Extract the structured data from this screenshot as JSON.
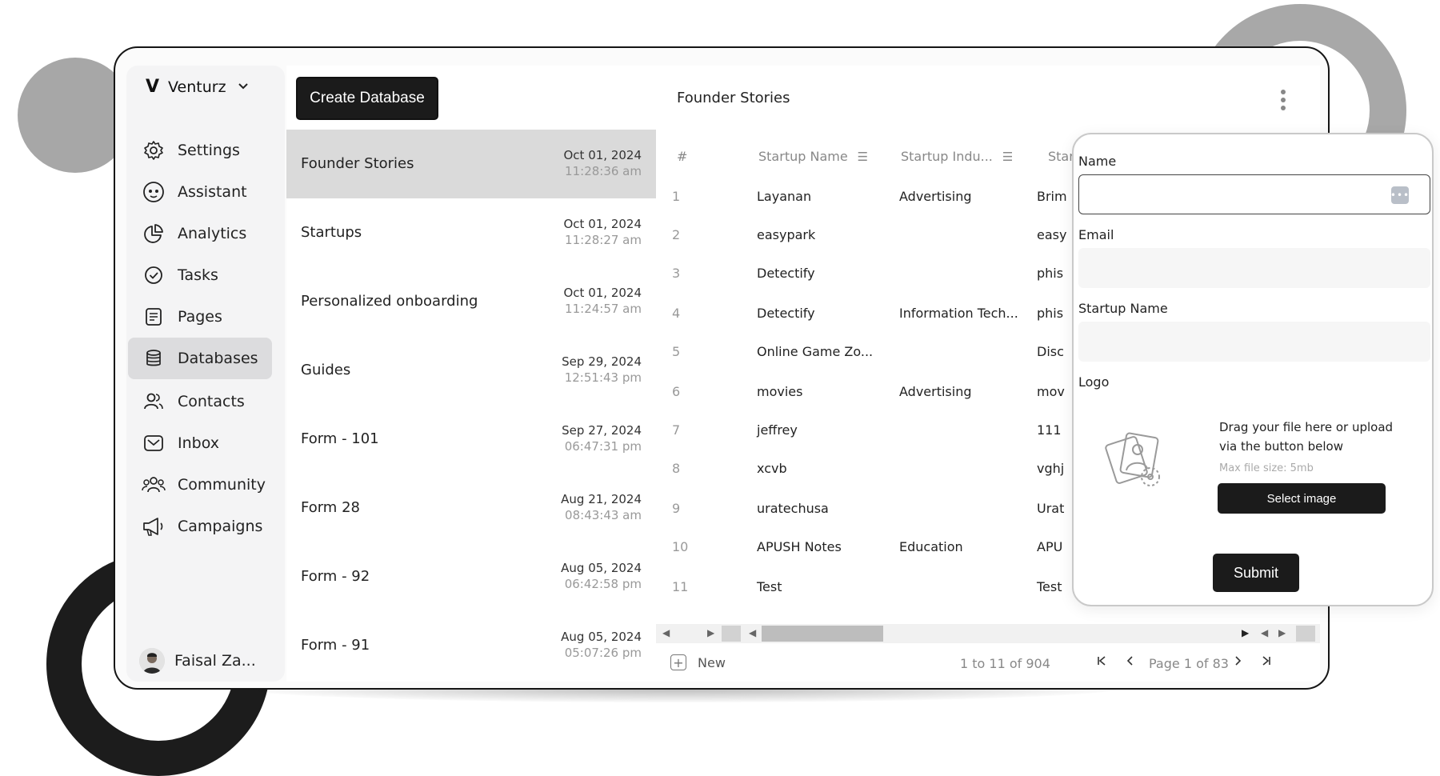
{
  "brand": {
    "name": "Venturz",
    "logo_letter": "V",
    "chevron_icon": "chevron-down-icon"
  },
  "sidebar": {
    "items": [
      {
        "label": "Settings",
        "icon": "gear-icon"
      },
      {
        "label": "Assistant",
        "icon": "assistant-face-icon"
      },
      {
        "label": "Analytics",
        "icon": "pie-chart-icon"
      },
      {
        "label": "Tasks",
        "icon": "check-circle-icon"
      },
      {
        "label": "Pages",
        "icon": "document-icon"
      },
      {
        "label": "Databases",
        "icon": "database-icon",
        "active": true
      },
      {
        "label": "Contacts",
        "icon": "users-icon"
      },
      {
        "label": "Inbox",
        "icon": "inbox-icon"
      },
      {
        "label": "Community",
        "icon": "community-icon"
      },
      {
        "label": "Campaigns",
        "icon": "megaphone-icon"
      }
    ],
    "user": {
      "name": "Faisal Za..."
    }
  },
  "database_list": {
    "create_label": "Create Database",
    "items": [
      {
        "name": "Founder Stories",
        "date": "Oct 01, 2024",
        "time": "11:28:36 am",
        "active": true
      },
      {
        "name": "Startups",
        "date": "Oct 01, 2024",
        "time": "11:28:27 am"
      },
      {
        "name": "Personalized onboarding",
        "date": "Oct 01, 2024",
        "time": "11:24:57 am"
      },
      {
        "name": "Guides",
        "date": "Sep 29, 2024",
        "time": "12:51:43 pm"
      },
      {
        "name": "Form - 101",
        "date": "Sep 27, 2024",
        "time": "06:47:31 pm"
      },
      {
        "name": "Form 28",
        "date": "Aug 21, 2024",
        "time": "08:43:43 am"
      },
      {
        "name": "Form - 92",
        "date": "Aug 05, 2024",
        "time": "06:42:58 pm"
      },
      {
        "name": "Form - 91",
        "date": "Aug 05, 2024",
        "time": "05:07:26 pm"
      }
    ]
  },
  "table": {
    "title": "Founder Stories",
    "columns": [
      "#",
      "Startup Name",
      "Startup Indu...",
      "Star"
    ],
    "rows": [
      {
        "num": "1",
        "name": "Layanan",
        "industry": "Advertising",
        "col3": "Brim"
      },
      {
        "num": "2",
        "name": "easypark",
        "industry": "",
        "col3": "easy"
      },
      {
        "num": "3",
        "name": "Detectify",
        "industry": "",
        "col3": "phis"
      },
      {
        "num": "4",
        "name": "Detectify",
        "industry": "Information Tech...",
        "col3": "phis"
      },
      {
        "num": "5",
        "name": "Online Game Zo...",
        "industry": "",
        "col3": "Disc"
      },
      {
        "num": "6",
        "name": "movies",
        "industry": "Advertising",
        "col3": "mov"
      },
      {
        "num": "7",
        "name": "jeffrey",
        "industry": "",
        "col3": "111"
      },
      {
        "num": "8",
        "name": "xcvb",
        "industry": "",
        "col3": "vghj"
      },
      {
        "num": "9",
        "name": "uratechusa",
        "industry": "",
        "col3": "Urat"
      },
      {
        "num": "10",
        "name": "APUSH Notes",
        "industry": "Education",
        "col3": "APU"
      },
      {
        "num": "11",
        "name": "Test",
        "industry": "",
        "col3": "Test"
      }
    ],
    "footer": {
      "new_label": "New",
      "range": "1 to 11 of 904",
      "page": "Page 1 of 83"
    }
  },
  "form": {
    "name_label": "Name",
    "email_label": "Email",
    "startup_label": "Startup Name",
    "logo_label": "Logo",
    "drag_text": "Drag your file here or upload via the button below",
    "max_size": "Max file size: 5mb",
    "select_label": "Select image",
    "submit_label": "Submit"
  }
}
